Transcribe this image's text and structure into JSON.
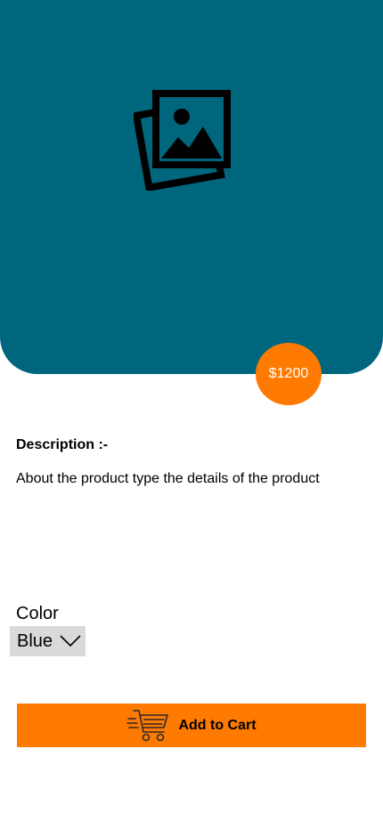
{
  "colors": {
    "hero_bg": "#00667e",
    "accent": "#ff7a00",
    "select_bg": "#d9d9d9"
  },
  "hero": {
    "icon": "image-gallery-icon"
  },
  "product": {
    "price": "$1200",
    "description_heading": "Description :-",
    "description_text": "About the product type the details of the product"
  },
  "color_selector": {
    "label": "Color",
    "selected": "Blue",
    "icon": "chevron-down-icon"
  },
  "cart": {
    "label": "Add to Cart",
    "icon": "shopping-cart-icon"
  }
}
